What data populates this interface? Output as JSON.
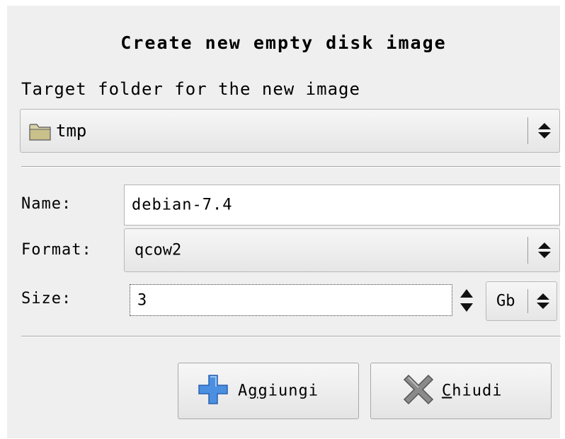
{
  "dialog": {
    "title": "Create new empty disk image",
    "target_label": "Target folder for the new image",
    "folder": {
      "value": "tmp",
      "icon": "folder-icon"
    },
    "name": {
      "label": "Name:",
      "value": "debian-7.4"
    },
    "format": {
      "label": "Format:",
      "value": "qcow2"
    },
    "size": {
      "label": "Size:",
      "value": "3",
      "unit": "Gb"
    },
    "buttons": {
      "add": {
        "pre": "A",
        "mnemonic": "g",
        "post": "giungi",
        "icon": "plus-icon",
        "color": "#3a7fd5"
      },
      "close": {
        "mnemonic": "C",
        "post": "hiudi",
        "icon": "close-x-icon"
      }
    }
  }
}
